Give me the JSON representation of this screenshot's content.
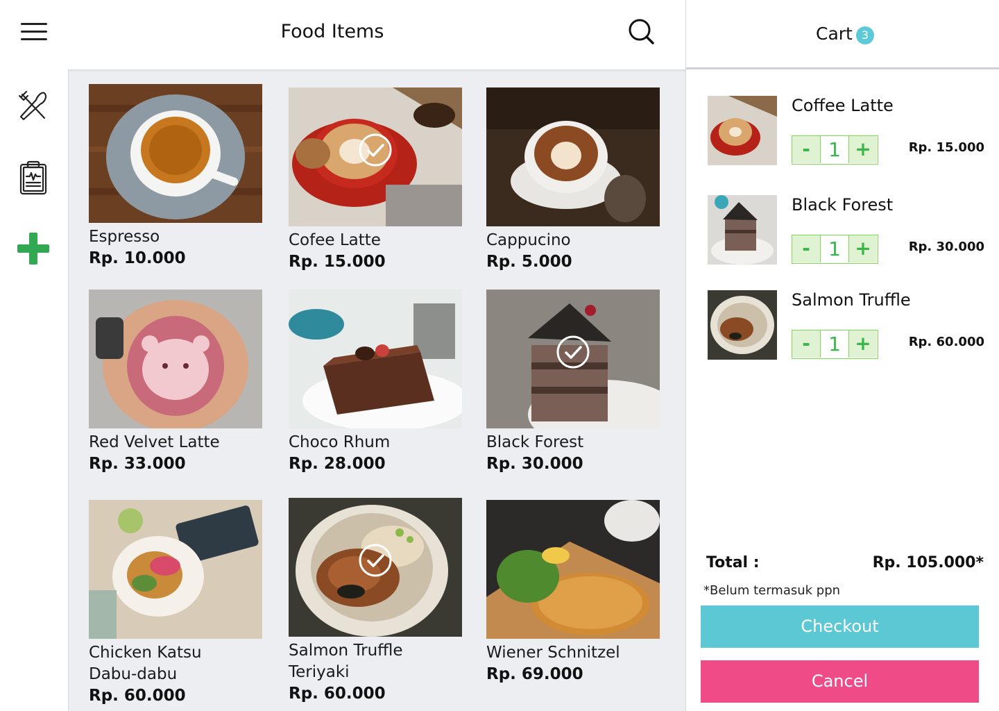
{
  "header": {
    "title": "Food Items"
  },
  "icons": {
    "menu": "hamburger-menu-icon",
    "search": "search-icon",
    "utensils": "fork-knife-icon",
    "report": "clipboard-report-icon",
    "add": "plus-icon",
    "check": "check-circle-icon"
  },
  "colors": {
    "accent_green": "#33a853",
    "badge": "#5bc9d6",
    "checkout": "#5bc8d4",
    "cancel": "#ef4c87",
    "stepper_border": "#7ed957"
  },
  "menu_items": [
    {
      "name": "Espresso",
      "price": "Rp. 10.000",
      "selected": false
    },
    {
      "name": "Cofee Latte",
      "price": "Rp. 15.000",
      "selected": true
    },
    {
      "name": "Cappucino",
      "price": "Rp. 5.000",
      "selected": false
    },
    {
      "name": "Red Velvet Latte",
      "price": "Rp. 33.000",
      "selected": false
    },
    {
      "name": "Choco Rhum",
      "price": "Rp. 28.000",
      "selected": false
    },
    {
      "name": "Black Forest",
      "price": "Rp. 30.000",
      "selected": true
    },
    {
      "name": "Chicken Katsu\nDabu-dabu",
      "price": "Rp. 60.000",
      "selected": false
    },
    {
      "name": "Salmon Truffle\nTeriyaki",
      "price": "Rp. 60.000",
      "selected": true
    },
    {
      "name": "Wiener Schnitzel",
      "price": "Rp. 69.000",
      "selected": false
    }
  ],
  "cart": {
    "title": "Cart",
    "count": "3",
    "items": [
      {
        "name": "Coffee Latte",
        "qty": "1",
        "minus": "-",
        "plus": "+",
        "price": "Rp. 15.000"
      },
      {
        "name": "Black Forest",
        "qty": "1",
        "minus": "-",
        "plus": "+",
        "price": "Rp. 30.000"
      },
      {
        "name": "Salmon Truffle",
        "qty": "1",
        "minus": "-",
        "plus": "+",
        "price": "Rp. 60.000"
      }
    ],
    "total_label": "Total :",
    "total_value": "Rp. 105.000*",
    "tax_note": "*Belum termasuk ppn",
    "checkout_label": "Checkout",
    "cancel_label": "Cancel"
  }
}
